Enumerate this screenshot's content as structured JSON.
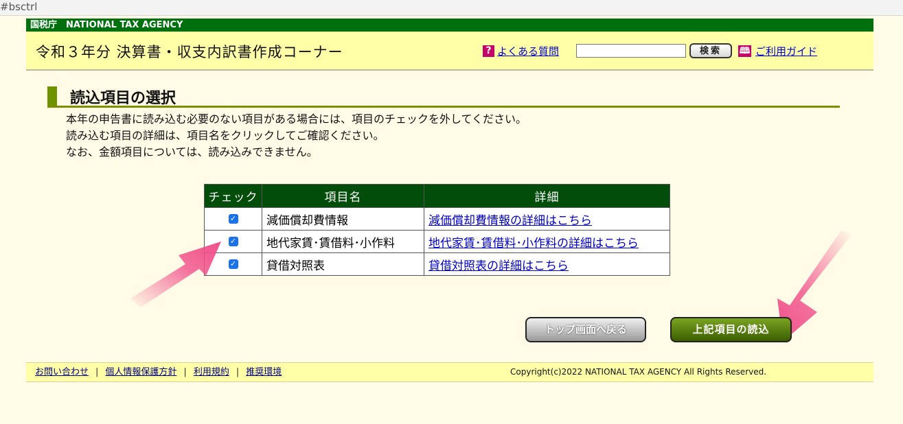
{
  "browser": {
    "url_fragment": "#bsctrl"
  },
  "agency_bar": {
    "label": "国税庁　NATIONAL TAX AGENCY"
  },
  "header": {
    "title": "令和３年分 決算書・収支内訳書作成コーナー",
    "faq_icon": "?",
    "faq_label": "よくある質問",
    "search_value": "",
    "search_button": "検索",
    "guide_icon": "🕮",
    "guide_label": "ご利用ガイド"
  },
  "section": {
    "title": "読込項目の選択",
    "lines": [
      "本年の申告書に読み込む必要のない項目がある場合には、項目のチェックを外してください。",
      "読み込む項目の詳細は、項目名をクリックしてご確認ください。",
      "なお、金額項目については、読み込みできません。"
    ]
  },
  "table": {
    "headers": [
      "チェック",
      "項目名",
      "詳細"
    ],
    "rows": [
      {
        "checked": true,
        "name": "減価償却費情報",
        "detail": "減価償却費情報の詳細はこちら"
      },
      {
        "checked": true,
        "name": "地代家賃･賃借料･小作料",
        "detail": "地代家賃･賃借料･小作料の詳細はこちら"
      },
      {
        "checked": true,
        "name": "貸借対照表",
        "detail": "貸借対照表の詳細はこちら"
      }
    ]
  },
  "buttons": {
    "back": "トップ画面へ戻る",
    "read": "上記項目の読込"
  },
  "footer": {
    "links": [
      "お問い合わせ",
      "個人情報保護方針",
      "利用規約",
      "推奨環境"
    ],
    "separator": "|",
    "copyright": "Copyright(c)2022 NATIONAL TAX AGENCY All Rights Reserved."
  },
  "colors": {
    "agency_green": "#00700e",
    "header_yellow": "#ffffa8",
    "table_header": "#034d0b",
    "annotation_arrow": "#f0508a"
  }
}
